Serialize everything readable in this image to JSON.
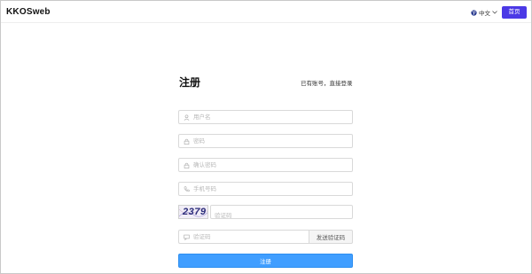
{
  "header": {
    "brand": "KKOSweb",
    "language": "中文",
    "home_button": "首页"
  },
  "form": {
    "title": "注册",
    "login_link": "已有账号，直接登录",
    "fields": {
      "username": {
        "placeholder": "用户名",
        "icon": "user-icon"
      },
      "password": {
        "placeholder": "密码",
        "icon": "lock-icon"
      },
      "confirm_password": {
        "placeholder": "确认密码",
        "icon": "lock-icon"
      },
      "phone": {
        "placeholder": "手机号码",
        "icon": "phone-icon"
      },
      "captcha": {
        "placeholder": "验证码",
        "image_text": "2379"
      },
      "sms_code": {
        "placeholder": "验证码",
        "icon": "message-icon"
      }
    },
    "send_code_button": "发送验证码",
    "submit_button": "注册"
  },
  "colors": {
    "primary": "#409eff",
    "home_button": "#4b39e6"
  }
}
